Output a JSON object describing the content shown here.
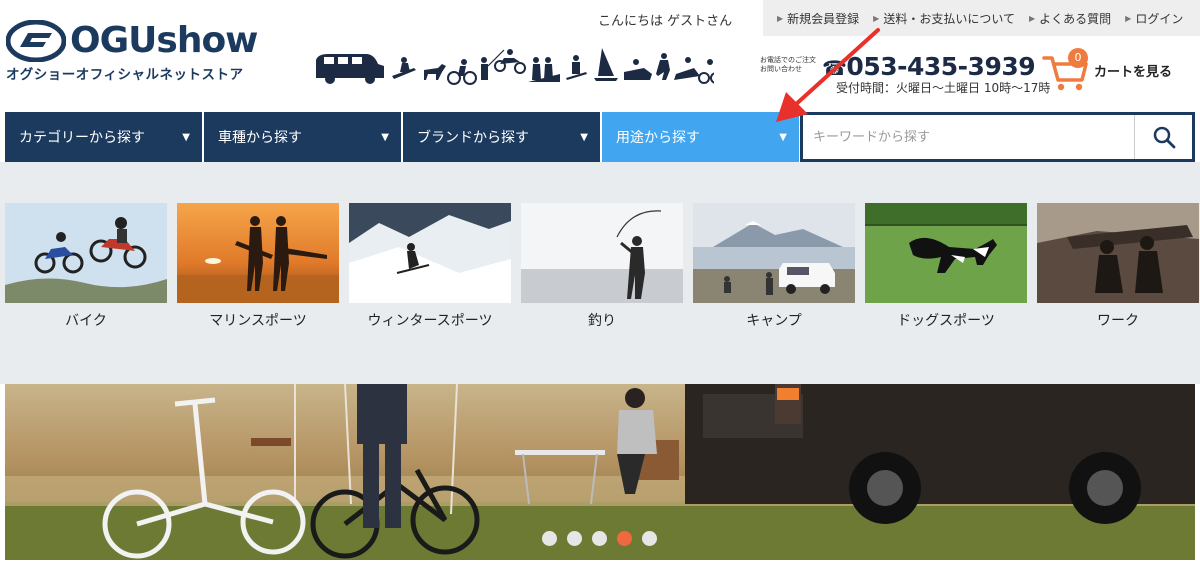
{
  "brand": {
    "logo_text": "OGUshow",
    "subtitle": "オグショーオフィシャルネットストア"
  },
  "header": {
    "greeting": "こんにちは ゲストさん",
    "top_links": [
      {
        "label": "新規会員登録"
      },
      {
        "label": "送料・お支払いについて"
      },
      {
        "label": "よくある質問"
      },
      {
        "label": "ログイン"
      }
    ],
    "phone": {
      "caption_line1": "お電話でのご注文",
      "caption_line2": "お問い合わせ",
      "number": "053-435-3939",
      "hours": "受付時間：火曜日〜土曜日 10時〜17時"
    },
    "cart": {
      "count": "0",
      "label": "カートを見る"
    }
  },
  "nav": {
    "items": [
      {
        "label": "カテゴリーから探す",
        "active": false
      },
      {
        "label": "車種から探す",
        "active": false
      },
      {
        "label": "ブランドから探す",
        "active": false
      },
      {
        "label": "用途から探す",
        "active": true
      }
    ],
    "caret": "▼",
    "search": {
      "placeholder": "キーワードから探す",
      "value": ""
    }
  },
  "categories": [
    {
      "label": "バイク"
    },
    {
      "label": "マリンスポーツ"
    },
    {
      "label": "ウィンタースポーツ"
    },
    {
      "label": "釣り"
    },
    {
      "label": "キャンプ"
    },
    {
      "label": "ドッグスポーツ"
    },
    {
      "label": "ワーク"
    }
  ],
  "hero": {
    "slide_count": 5,
    "active_slide": 4
  },
  "colors": {
    "navy": "#1c3a5e",
    "nav_active": "#42a5f0",
    "accent_orange": "#f07b3f",
    "annotation_red": "#e8312a"
  }
}
